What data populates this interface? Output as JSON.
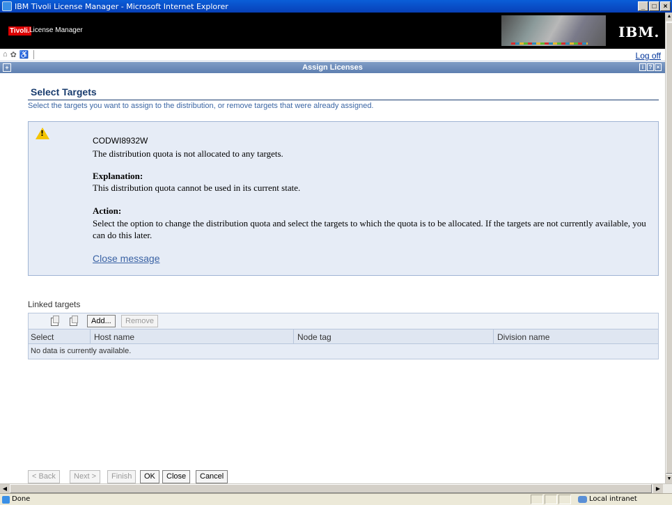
{
  "window": {
    "title": "IBM Tivoli License Manager - Microsoft Internet Explorer",
    "buttons": [
      "_",
      "□",
      "×"
    ]
  },
  "banner": {
    "brand": "Tivoli.",
    "product": "License Manager",
    "logo_text": "IBM."
  },
  "toolbar": {
    "logoff_label": "Log off"
  },
  "portlet": {
    "title": "Assign Licenses",
    "controls": [
      "i",
      "?",
      "×"
    ]
  },
  "page": {
    "title": "Select Targets",
    "description": "Select the targets you want to assign to the distribution, or remove targets that were already assigned."
  },
  "message": {
    "code": "CODWI8932W",
    "summary": "The distribution quota is not allocated to any targets.",
    "explanation_heading": "Explanation:",
    "explanation": "This distribution quota cannot be used in its current state.",
    "action_heading": "Action:",
    "action": "Select the option to change the distribution quota and select the targets to which the quota is to be allocated. If the targets are not currently available, you can do this later.",
    "close_label": "Close message"
  },
  "linked_targets": {
    "label": "Linked targets",
    "add_label": "Add...",
    "remove_label": "Remove",
    "columns": [
      "Select",
      "Host name",
      "Node tag",
      "Division name"
    ],
    "empty_text": "No data is currently available."
  },
  "wizard": {
    "back_label": "< Back",
    "next_label": "Next >",
    "finish_label": "Finish",
    "ok_label": "OK",
    "close_label": "Close",
    "cancel_label": "Cancel"
  },
  "statusbar": {
    "status": "Done",
    "zone": "Local intranet"
  }
}
